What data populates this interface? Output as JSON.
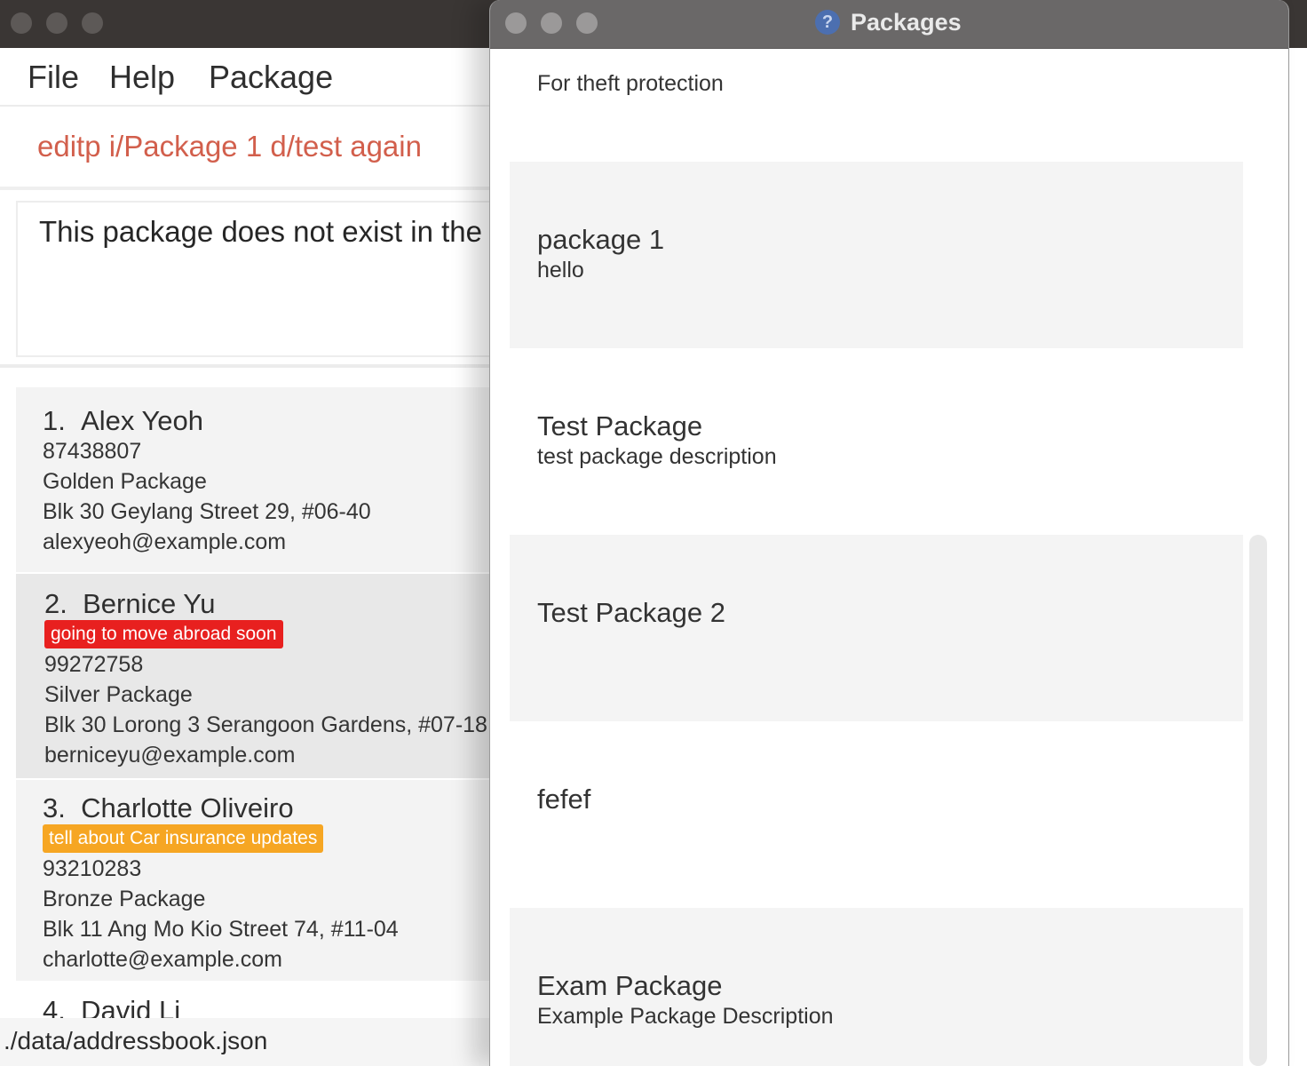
{
  "main_window": {
    "menu": {
      "file": "File",
      "help": "Help",
      "package": "Package"
    },
    "command_input_value": "editp i/Package 1 d/test again",
    "result_message": "This package does not exist in the address book",
    "persons": [
      {
        "index": "1.",
        "name": "Alex Yeoh",
        "phone": "87438807",
        "package": "Golden Package",
        "address": "Blk 30 Geylang Street 29, #06-40",
        "email": "alexyeoh@example.com"
      },
      {
        "index": "2.",
        "name": "Bernice Yu",
        "tag": "going to move abroad soon",
        "phone": "99272758",
        "package": "Silver Package",
        "address": "Blk 30 Lorong 3 Serangoon Gardens, #07-18",
        "email": "berniceyu@example.com"
      },
      {
        "index": "3.",
        "name": "Charlotte Oliveiro",
        "tag": "tell about Car insurance updates",
        "phone": "93210283",
        "package": "Bronze Package",
        "address": "Blk 11 Ang Mo Kio Street 74, #11-04",
        "email": "charlotte@example.com"
      },
      {
        "index": "4.",
        "name": "David Li"
      }
    ],
    "status_bar_path": "./data/addressbook.json"
  },
  "packages_window": {
    "title": "Packages",
    "title_icon": "help-icon",
    "packages": [
      {
        "name": "",
        "description": "For theft protection"
      },
      {
        "name": "package 1",
        "description": "hello"
      },
      {
        "name": "Test Package",
        "description": "test package description"
      },
      {
        "name": "Test Package 2",
        "description": ""
      },
      {
        "name": "fefef",
        "description": ""
      },
      {
        "name": "Exam Package",
        "description": "Example Package Description"
      }
    ]
  },
  "colors": {
    "titlebar_main": "#3a3634",
    "titlebar_packages": "#6a6868",
    "command_text": "#d25f4c",
    "tag_red": "#e8201f",
    "tag_orange": "#f6a623"
  }
}
